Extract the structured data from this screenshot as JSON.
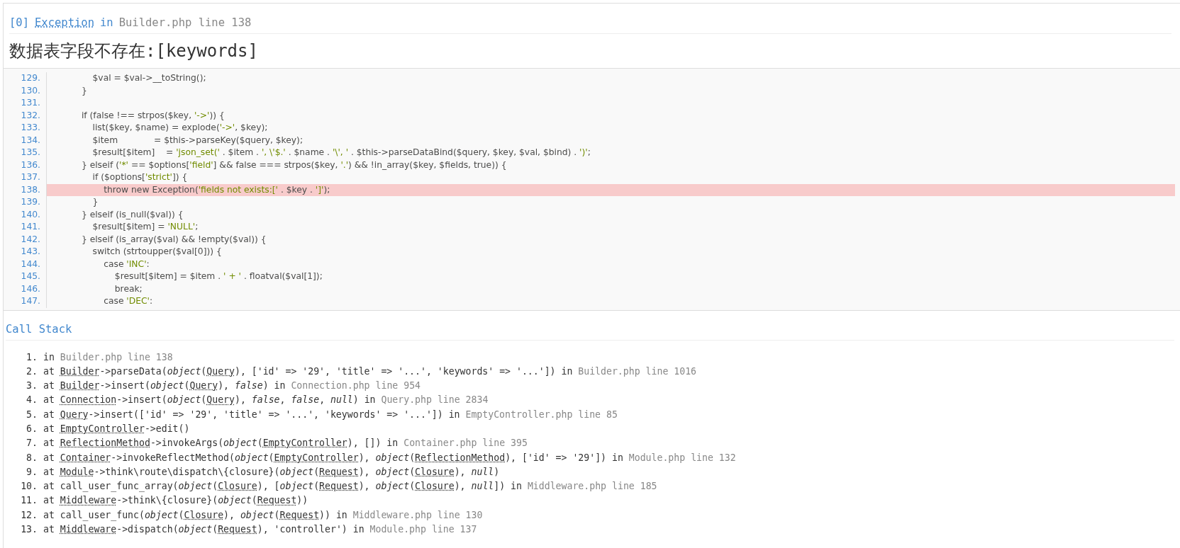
{
  "exception": {
    "index": "[0]",
    "class": "Exception",
    "in": "in",
    "location": "Builder.php line 138"
  },
  "message": "数据表字段不存在:[keywords]",
  "source": [
    {
      "number": "129.",
      "code": "                $val = $val->__toString();",
      "highlighted": false
    },
    {
      "number": "130.",
      "code": "            }",
      "highlighted": false
    },
    {
      "number": "131.",
      "highlighted": false
    },
    {
      "number": "132.",
      "code": "            if (false !== strpos($key, '->')) {",
      "highlighted": false
    },
    {
      "number": "133.",
      "code": "                list($key, $name) = explode('->', $key);",
      "highlighted": false
    },
    {
      "number": "134.",
      "code": "                $item             = $this->parseKey($query, $key);",
      "highlighted": false
    },
    {
      "number": "135.",
      "code": "                $result[$item]    = 'json_set(' . $item . ', \\'$.' . $name . '\\', ' . $this->parseDataBind($query, $key, $val, $bind) . ')';",
      "highlighted": false
    },
    {
      "number": "136.",
      "code": "            } elseif ('*' == $options['field'] && false === strpos($key, '.') && !in_array($key, $fields, true)) {",
      "highlighted": false
    },
    {
      "number": "137.",
      "code": "                if ($options['strict']) {",
      "highlighted": false
    },
    {
      "number": "138.",
      "code": "                    throw new Exception('fields not exists:[' . $key . ']');",
      "highlighted": true
    },
    {
      "number": "139.",
      "code": "                }",
      "highlighted": false
    },
    {
      "number": "140.",
      "code": "            } elseif (is_null($val)) {",
      "highlighted": false
    },
    {
      "number": "141.",
      "code": "                $result[$item] = 'NULL';",
      "highlighted": false
    },
    {
      "number": "142.",
      "code": "            } elseif (is_array($val) && !empty($val)) {",
      "highlighted": false
    },
    {
      "number": "143.",
      "code": "                switch (strtoupper($val[0])) {",
      "highlighted": false
    },
    {
      "number": "144.",
      "code": "                    case 'INC':",
      "highlighted": false
    },
    {
      "number": "145.",
      "code": "                        $result[$item] = $item . ' + ' . floatval($val[1]);",
      "highlighted": false
    },
    {
      "number": "146.",
      "code": "                        break;",
      "highlighted": false
    },
    {
      "number": "147.",
      "code": "                    case 'DEC':",
      "highlighted": false
    }
  ],
  "call_stack": {
    "title": "Call Stack",
    "frames": [
      {
        "number": "1.",
        "parts": [
          {
            "kind": "text",
            "text": "in "
          },
          {
            "kind": "file",
            "text": "Builder.php line 138"
          }
        ]
      },
      {
        "number": "2.",
        "parts": [
          {
            "kind": "text",
            "text": "at "
          },
          {
            "kind": "class",
            "text": "Builder"
          },
          {
            "kind": "text",
            "text": "->parseData(*object*("
          },
          {
            "kind": "class",
            "text": "Query"
          },
          {
            "kind": "text",
            "text": "), ['id' => '29', 'title' => '...', 'keywords' => '...']) in "
          },
          {
            "kind": "file",
            "text": "Builder.php line 1016"
          }
        ]
      },
      {
        "number": "3.",
        "parts": [
          {
            "kind": "text",
            "text": "at "
          },
          {
            "kind": "class",
            "text": "Builder"
          },
          {
            "kind": "text",
            "text": "->insert(*object*("
          },
          {
            "kind": "class",
            "text": "Query"
          },
          {
            "kind": "text",
            "text": "), *false*) in "
          },
          {
            "kind": "file",
            "text": "Connection.php line 954"
          }
        ]
      },
      {
        "number": "4.",
        "parts": [
          {
            "kind": "text",
            "text": "at "
          },
          {
            "kind": "class",
            "text": "Connection"
          },
          {
            "kind": "text",
            "text": "->insert(*object*("
          },
          {
            "kind": "class",
            "text": "Query"
          },
          {
            "kind": "text",
            "text": "), *false*, *false*, *null*) in "
          },
          {
            "kind": "file",
            "text": "Query.php line 2834"
          }
        ]
      },
      {
        "number": "5.",
        "parts": [
          {
            "kind": "text",
            "text": "at "
          },
          {
            "kind": "class",
            "text": "Query"
          },
          {
            "kind": "text",
            "text": "->insert(['id' => '29', 'title' => '...', 'keywords' => '...']) in "
          },
          {
            "kind": "file",
            "text": "EmptyController.php line 85"
          }
        ]
      },
      {
        "number": "6.",
        "parts": [
          {
            "kind": "text",
            "text": "at "
          },
          {
            "kind": "class",
            "text": "EmptyController"
          },
          {
            "kind": "text",
            "text": "->edit()"
          }
        ]
      },
      {
        "number": "7.",
        "parts": [
          {
            "kind": "text",
            "text": "at "
          },
          {
            "kind": "class",
            "text": "ReflectionMethod"
          },
          {
            "kind": "text",
            "text": "->invokeArgs(*object*("
          },
          {
            "kind": "class",
            "text": "EmptyController"
          },
          {
            "kind": "text",
            "text": "), []) in "
          },
          {
            "kind": "file",
            "text": "Container.php line 395"
          }
        ]
      },
      {
        "number": "8.",
        "parts": [
          {
            "kind": "text",
            "text": "at "
          },
          {
            "kind": "class",
            "text": "Container"
          },
          {
            "kind": "text",
            "text": "->invokeReflectMethod(*object*("
          },
          {
            "kind": "class",
            "text": "EmptyController"
          },
          {
            "kind": "text",
            "text": "), *object*("
          },
          {
            "kind": "class",
            "text": "ReflectionMethod"
          },
          {
            "kind": "text",
            "text": "), ['id' => '29']) in "
          },
          {
            "kind": "file",
            "text": "Module.php line 132"
          }
        ]
      },
      {
        "number": "9.",
        "parts": [
          {
            "kind": "text",
            "text": "at "
          },
          {
            "kind": "class",
            "text": "Module"
          },
          {
            "kind": "text",
            "text": "->think\\route\\dispatch\\{closure}(*object*("
          },
          {
            "kind": "class",
            "text": "Request"
          },
          {
            "kind": "text",
            "text": "), *object*("
          },
          {
            "kind": "class",
            "text": "Closure"
          },
          {
            "kind": "text",
            "text": "), *null*)"
          }
        ]
      },
      {
        "number": "10.",
        "parts": [
          {
            "kind": "text",
            "text": "at call_user_func_array(*object*("
          },
          {
            "kind": "class",
            "text": "Closure"
          },
          {
            "kind": "text",
            "text": "), [*object*("
          },
          {
            "kind": "class",
            "text": "Request"
          },
          {
            "kind": "text",
            "text": "), *object*("
          },
          {
            "kind": "class",
            "text": "Closure"
          },
          {
            "kind": "text",
            "text": "), *null*]) in "
          },
          {
            "kind": "file",
            "text": "Middleware.php line 185"
          }
        ]
      },
      {
        "number": "11.",
        "parts": [
          {
            "kind": "text",
            "text": "at "
          },
          {
            "kind": "class",
            "text": "Middleware"
          },
          {
            "kind": "text",
            "text": "->think\\{closure}(*object*("
          },
          {
            "kind": "class",
            "text": "Request"
          },
          {
            "kind": "text",
            "text": "))"
          }
        ]
      },
      {
        "number": "12.",
        "parts": [
          {
            "kind": "text",
            "text": "at call_user_func(*object*("
          },
          {
            "kind": "class",
            "text": "Closure"
          },
          {
            "kind": "text",
            "text": "), *object*("
          },
          {
            "kind": "class",
            "text": "Request"
          },
          {
            "kind": "text",
            "text": ")) in "
          },
          {
            "kind": "file",
            "text": "Middleware.php line 130"
          }
        ]
      },
      {
        "number": "13.",
        "parts": [
          {
            "kind": "text",
            "text": "at "
          },
          {
            "kind": "class",
            "text": "Middleware"
          },
          {
            "kind": "text",
            "text": "->dispatch(*object*("
          },
          {
            "kind": "class",
            "text": "Request"
          },
          {
            "kind": "text",
            "text": "), 'controller') in "
          },
          {
            "kind": "file",
            "text": "Module.php line 137"
          }
        ]
      }
    ]
  }
}
